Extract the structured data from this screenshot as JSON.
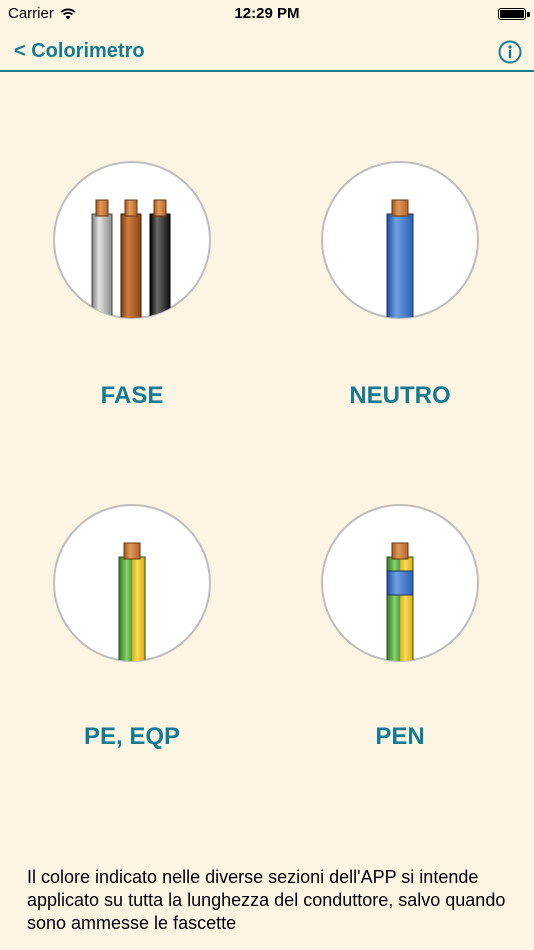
{
  "status_bar": {
    "carrier": "Carrier",
    "time": "12:29 PM"
  },
  "nav": {
    "back_label": "< Colorimetro",
    "info_icon": "info-icon"
  },
  "cables": [
    {
      "label": "FASE"
    },
    {
      "label": "NEUTRO"
    },
    {
      "label": "PE, EQP"
    },
    {
      "label": "PEN"
    }
  ],
  "colors": {
    "accent": "#177a93",
    "background": "#fcf5e4",
    "copper": "#c8763a",
    "grey_wire": "#a9a9a9",
    "brown_wire": "#a0561e",
    "black_wire": "#1c1c1c",
    "blue_wire": "#3b73c9",
    "green_wire": "#4f9e3a",
    "yellow_wire": "#e9c21c"
  },
  "footer": {
    "note": "Il colore indicato nelle diverse sezioni dell'APP si intende applicato su tutta la lunghezza del conduttore, salvo quando sono ammesse le fascette"
  }
}
